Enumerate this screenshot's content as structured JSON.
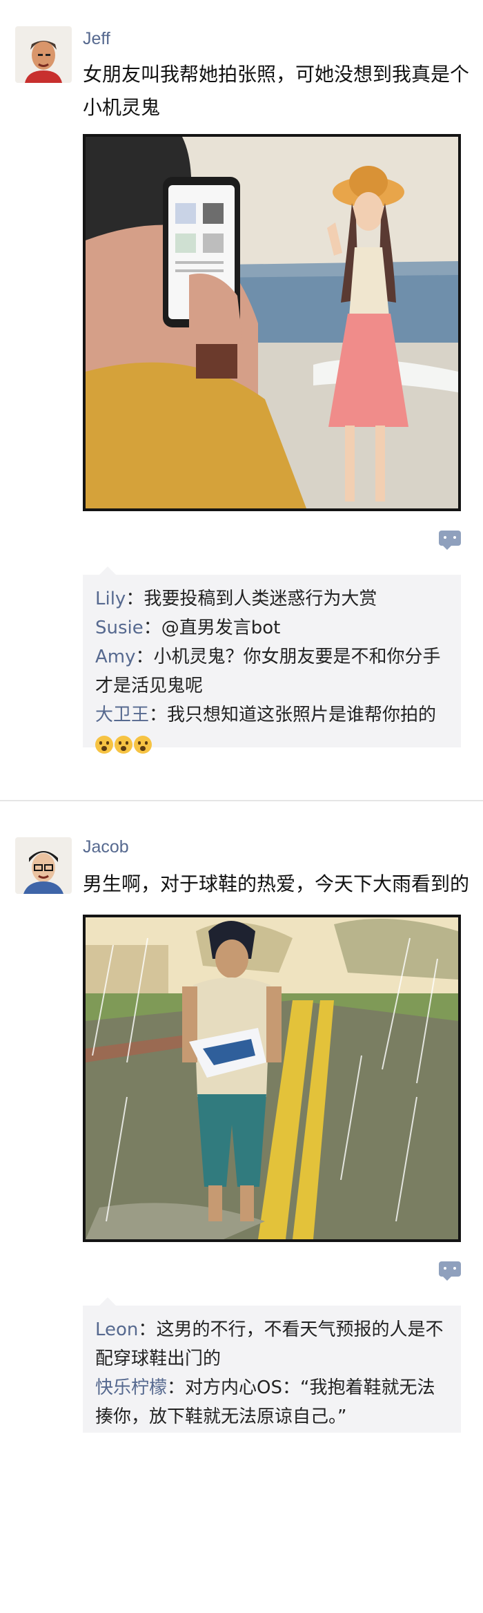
{
  "posts": [
    {
      "user": "Jeff",
      "text": "女朋友叫我帮她拍张照，可她没想到我真是个小机灵鬼",
      "comments": [
        {
          "user": "Lily",
          "text": "我要投稿到人类迷惑行为大赏"
        },
        {
          "user": "Susie",
          "text": "@直男发言bot"
        },
        {
          "user": "Amy",
          "text": "小机灵鬼？你女朋友要是不和你分手才是活见鬼呢"
        },
        {
          "user": "大卫王",
          "text": "我只想知道这张照片是谁帮你拍的"
        }
      ]
    },
    {
      "user": "Jacob",
      "text": "男生啊，对于球鞋的热爱，今天下大雨看到的",
      "comments": [
        {
          "user": "Leon",
          "text": "这男的不行，不看天气预报的人是不配穿球鞋出门的"
        },
        {
          "user": "快乐柠檬",
          "text": "对方内心OS：“我抱着鞋就无法揍你，放下鞋就无法原谅自己。”"
        }
      ]
    }
  ],
  "icons": {
    "comment": "comment-bubble-icon",
    "emoji": "grimace-emoji"
  },
  "colors": {
    "username": "#56698f",
    "comment_bg": "#f3f3f5"
  }
}
